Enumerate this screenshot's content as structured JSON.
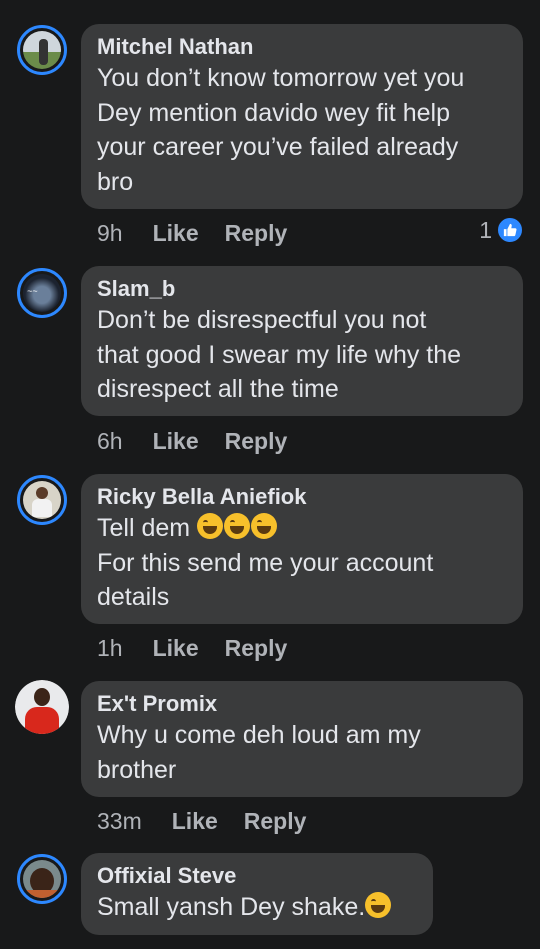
{
  "comments": [
    {
      "author": "Mitchel Nathan",
      "text": "You don’t know tomorrow yet you\nDey mention davido wey fit help\nyour career you’ve failed already\nbro",
      "time": "9h",
      "like": "Like",
      "reply": "Reply",
      "reaction_count": "1"
    },
    {
      "author": "Slam_b",
      "text": "Don’t be disrespectful you not\nthat good I swear my life why the\ndisrespect all the time",
      "time": "6h",
      "like": "Like",
      "reply": "Reply"
    },
    {
      "author": "Ricky Bella Aniefiok",
      "text_line1": "Tell dem ",
      "text_rest": "For this send me your account\ndetails",
      "time": "1h",
      "like": "Like",
      "reply": "Reply"
    },
    {
      "author": "Ex't Promix",
      "text": "Why u come deh loud am my\nbrother",
      "time": "33m",
      "like": "Like",
      "reply": "Reply"
    },
    {
      "author": "Offixial Steve",
      "text": "Small yansh Dey shake.",
      "time": "",
      "like": "",
      "reply": ""
    }
  ],
  "colors": {
    "background": "#18191a",
    "bubble": "#3a3b3c",
    "accent": "#2d88ff",
    "meta_text": "#b0b3b8"
  },
  "icons": {
    "reaction": "thumbs-up-icon",
    "emoji": "laughing-emoji-icon"
  }
}
